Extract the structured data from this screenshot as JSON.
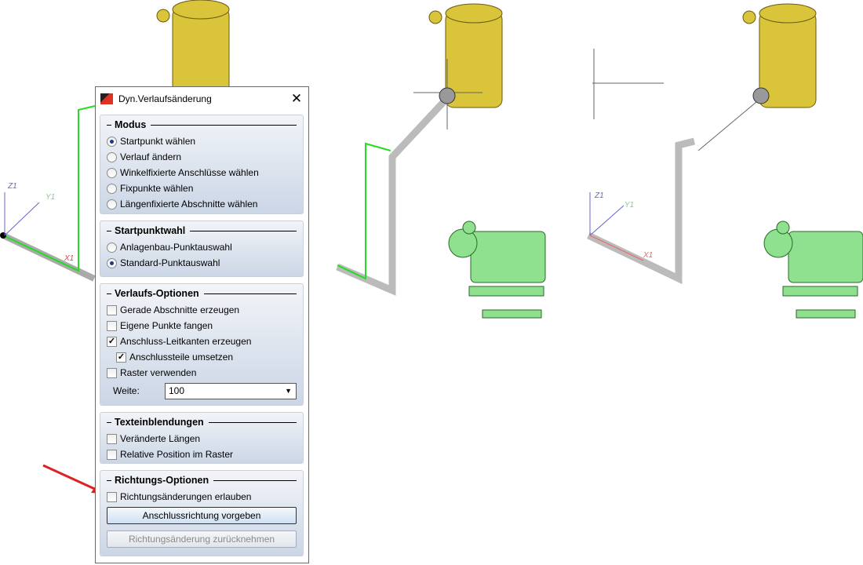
{
  "dialog": {
    "title": "Dyn.Verlaufsänderung",
    "close": "✕"
  },
  "modus": {
    "title": "Modus",
    "options": [
      "Startpunkt wählen",
      "Verlauf ändern",
      "Winkelfixierte Anschlüsse wählen",
      "Fixpunkte wählen",
      "Längenfixierte Abschnitte wählen"
    ],
    "selected": 0
  },
  "startpunktwahl": {
    "title": "Startpunktwahl",
    "options": [
      "Anlagenbau-Punktauswahl",
      "Standard-Punktauswahl"
    ],
    "selected": 1
  },
  "verlauf": {
    "title": "Verlaufs-Optionen",
    "items": [
      {
        "label": "Gerade Abschnitte erzeugen",
        "checked": false
      },
      {
        "label": "Eigene Punkte fangen",
        "checked": false
      },
      {
        "label": "Anschluss-Leitkanten erzeugen",
        "checked": true
      },
      {
        "label": "Anschlussteile umsetzen",
        "checked": true
      },
      {
        "label": "Raster verwenden",
        "checked": false
      }
    ],
    "weite_label": "Weite:",
    "weite_value": "100"
  },
  "text": {
    "title": "Texteinblendungen",
    "items": [
      {
        "label": "Veränderte Längen",
        "checked": false
      },
      {
        "label": "Relative Position im Raster",
        "checked": false
      }
    ]
  },
  "richtung": {
    "title": "Richtungs-Optionen",
    "item": {
      "label": "Richtungsänderungen erlauben",
      "checked": false
    },
    "btn1": "Anschlussrichtung vorgeben",
    "btn2": "Richtungsänderung zurücknehmen"
  },
  "axes": {
    "z": "Z1",
    "y": "Y1",
    "x": "X1"
  },
  "colors": {
    "tank": "#d9c43a",
    "pump": "#8fe08f",
    "pipe": "#c8c8c8",
    "route": "#22dd22"
  }
}
